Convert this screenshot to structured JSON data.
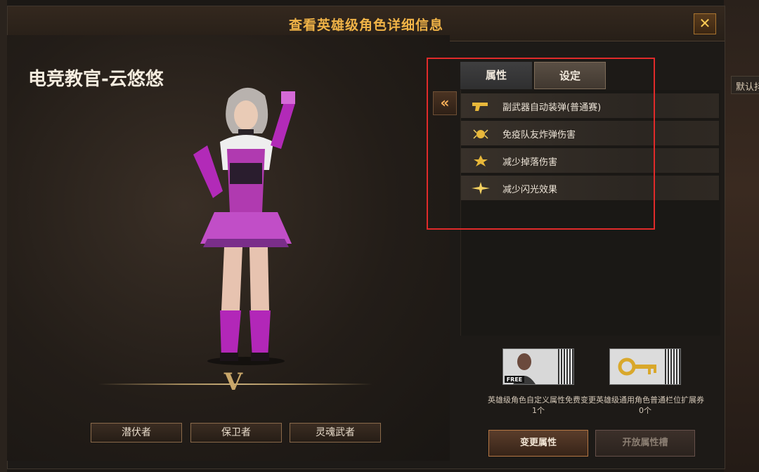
{
  "window": {
    "title": "查看英雄级角色详细信息",
    "close_icon": "close-icon"
  },
  "background": {
    "right_tag": "默认抖"
  },
  "character": {
    "name": "电竞教官-云悠悠",
    "rank_badge": "V"
  },
  "skills": [
    {
      "label": "潜伏者"
    },
    {
      "label": "保卫者"
    },
    {
      "label": "灵魂武者"
    }
  ],
  "tabs": [
    {
      "label": "属性"
    },
    {
      "label": "设定"
    }
  ],
  "collapse_icon": "double-chevron-left-icon",
  "attributes": [
    {
      "label": "副武器自动装弹(普通赛)",
      "icon": "pistol-icon"
    },
    {
      "label": "免疫队友炸弹伤害",
      "icon": "grenade-icon"
    },
    {
      "label": "减少掉落伤害",
      "icon": "fall-damage-icon"
    },
    {
      "label": "减少闪光效果",
      "icon": "flash-icon"
    }
  ],
  "coupons": [
    {
      "label": "英雄级角色自定义属性免费变更",
      "count": "1个",
      "art_text": "FREE"
    },
    {
      "label": "英雄级通用角色普通栏位扩展券",
      "count": "0个"
    }
  ],
  "actions": {
    "change_attr": "变更属性",
    "open_slot": "开放属性槽"
  },
  "colors": {
    "accent": "#f0b347",
    "highlight": "#e02a2a"
  }
}
